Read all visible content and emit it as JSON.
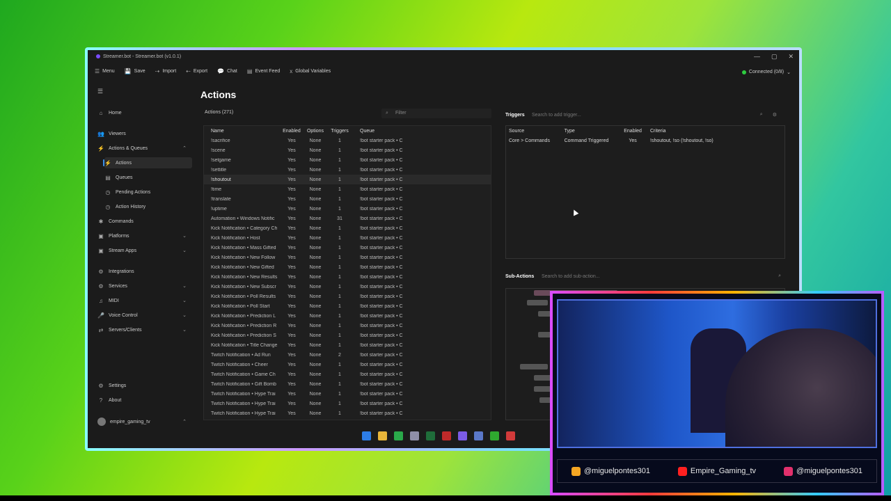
{
  "window": {
    "title": "Streamer.bot - Streamer.bot (v1.0.1)"
  },
  "toolbar": [
    {
      "icon": "☰",
      "label": "Menu"
    },
    {
      "icon": "💾",
      "label": "Save"
    },
    {
      "icon": "⇢",
      "label": "Import"
    },
    {
      "icon": "⇠",
      "label": "Export"
    },
    {
      "icon": "💬",
      "label": "Chat"
    },
    {
      "icon": "▤",
      "label": "Event Feed"
    },
    {
      "icon": "x",
      "label": "Global Variables"
    }
  ],
  "connection": {
    "label": "Connected (0/8)"
  },
  "sidebar": {
    "items": [
      {
        "label": "Home",
        "icon": "⌂"
      },
      {
        "label": "Viewers",
        "icon": "👥"
      },
      {
        "label": "Actions & Queues",
        "icon": "⚡"
      },
      {
        "label": "Actions",
        "icon": "⚡"
      },
      {
        "label": "Queues",
        "icon": "▤"
      },
      {
        "label": "Pending Actions",
        "icon": "◷"
      },
      {
        "label": "Action History",
        "icon": "◷"
      },
      {
        "label": "Commands",
        "icon": "✱"
      },
      {
        "label": "Platforms",
        "icon": "▣"
      },
      {
        "label": "Stream Apps",
        "icon": "▣"
      },
      {
        "label": "Integrations",
        "icon": "⚙"
      },
      {
        "label": "Services",
        "icon": "⚙"
      },
      {
        "label": "MIDI",
        "icon": "♫"
      },
      {
        "label": "Voice Control",
        "icon": "🎤"
      },
      {
        "label": "Servers/Clients",
        "icon": "⇄"
      },
      {
        "label": "Settings",
        "icon": "⚙"
      },
      {
        "label": "About",
        "icon": "?"
      }
    ],
    "user": "empire_gaming_tv"
  },
  "page": {
    "title": "Actions"
  },
  "actions": {
    "label": "Actions (271)",
    "filter_placeholder": "Filter",
    "columns": [
      "Name",
      "Enabled",
      "Options",
      "Triggers",
      "Queue"
    ],
    "rows": [
      [
        "!sacrifice",
        "Yes",
        "None",
        "1",
        "!bot starter pack • C"
      ],
      [
        "!scene",
        "Yes",
        "None",
        "1",
        "!bot starter pack • C"
      ],
      [
        "!setgame",
        "Yes",
        "None",
        "1",
        "!bot starter pack • C"
      ],
      [
        "!settitle",
        "Yes",
        "None",
        "1",
        "!bot starter pack • C"
      ],
      [
        "!shoutout",
        "Yes",
        "None",
        "1",
        "!bot starter pack • C"
      ],
      [
        "!time",
        "Yes",
        "None",
        "1",
        "!bot starter pack • C"
      ],
      [
        "!translate",
        "Yes",
        "None",
        "1",
        "!bot starter pack • C"
      ],
      [
        "!uptime",
        "Yes",
        "None",
        "1",
        "!bot starter pack • C"
      ],
      [
        "Automation • Windows Notific",
        "Yes",
        "None",
        "31",
        "!bot starter pack • C"
      ],
      [
        "Kick Notification • Category Ch",
        "Yes",
        "None",
        "1",
        "!bot starter pack • C"
      ],
      [
        "Kick Notification • Host",
        "Yes",
        "None",
        "1",
        "!bot starter pack • C"
      ],
      [
        "Kick Notification • Mass Gifted",
        "Yes",
        "None",
        "1",
        "!bot starter pack • C"
      ],
      [
        "Kick Notification • New Follow",
        "Yes",
        "None",
        "1",
        "!bot starter pack • C"
      ],
      [
        "Kick Notification • New Gifted",
        "Yes",
        "None",
        "1",
        "!bot starter pack • C"
      ],
      [
        "Kick Notification • New Results",
        "Yes",
        "None",
        "1",
        "!bot starter pack • C"
      ],
      [
        "Kick Notification • New Subscr",
        "Yes",
        "None",
        "1",
        "!bot starter pack • C"
      ],
      [
        "Kick Notification • Poll Results",
        "Yes",
        "None",
        "1",
        "!bot starter pack • C"
      ],
      [
        "Kick Notification • Poll Start",
        "Yes",
        "None",
        "1",
        "!bot starter pack • C"
      ],
      [
        "Kick Notification • Prediction L",
        "Yes",
        "None",
        "1",
        "!bot starter pack • C"
      ],
      [
        "Kick Notification • Prediction R",
        "Yes",
        "None",
        "1",
        "!bot starter pack • C"
      ],
      [
        "Kick Notification • Prediction S",
        "Yes",
        "None",
        "1",
        "!bot starter pack • C"
      ],
      [
        "Kick Notification • Title Change",
        "Yes",
        "None",
        "1",
        "!bot starter pack • C"
      ],
      [
        "Twitch Notification • Ad Run",
        "Yes",
        "None",
        "2",
        "!bot starter pack • C"
      ],
      [
        "Twitch Notification • Cheer",
        "Yes",
        "None",
        "1",
        "!bot starter pack • C"
      ],
      [
        "Twitch Notification • Game Ch",
        "Yes",
        "None",
        "1",
        "!bot starter pack • C"
      ],
      [
        "Twitch Notification • Gift Bomb",
        "Yes",
        "None",
        "1",
        "!bot starter pack • C"
      ],
      [
        "Twitch Notification • Hype Trai",
        "Yes",
        "None",
        "1",
        "!bot starter pack • C"
      ],
      [
        "Twitch Notification • Hype Trai",
        "Yes",
        "None",
        "1",
        "!bot starter pack • C"
      ],
      [
        "Twitch Notification • Hype Trai",
        "Yes",
        "None",
        "1",
        "!bot starter pack • C"
      ]
    ]
  },
  "triggers": {
    "title": "Triggers",
    "search_placeholder": "Search to add trigger...",
    "columns": [
      "Source",
      "Type",
      "Enabled",
      "Criteria"
    ],
    "rows": [
      [
        "Core > Commands",
        "Command Triggered",
        "Yes",
        "!shoutout, !so (!shoutout, !so)"
      ]
    ]
  },
  "subactions": {
    "title": "Sub-Actions",
    "search_placeholder": "Search to add sub-action..."
  },
  "stream_overlay": {
    "socials": [
      {
        "icon": "kick-icon",
        "color": "#f5a623",
        "handle": "@miguelpontes301"
      },
      {
        "icon": "youtube-icon",
        "color": "#ff2020",
        "handle": "Empire_Gaming_tv"
      },
      {
        "icon": "instagram-icon",
        "color": "#e1306c",
        "handle": "@miguelpontes301"
      }
    ]
  },
  "colors": {
    "accent": "#3a8ee6",
    "window_bg": "#1b1b1b"
  }
}
